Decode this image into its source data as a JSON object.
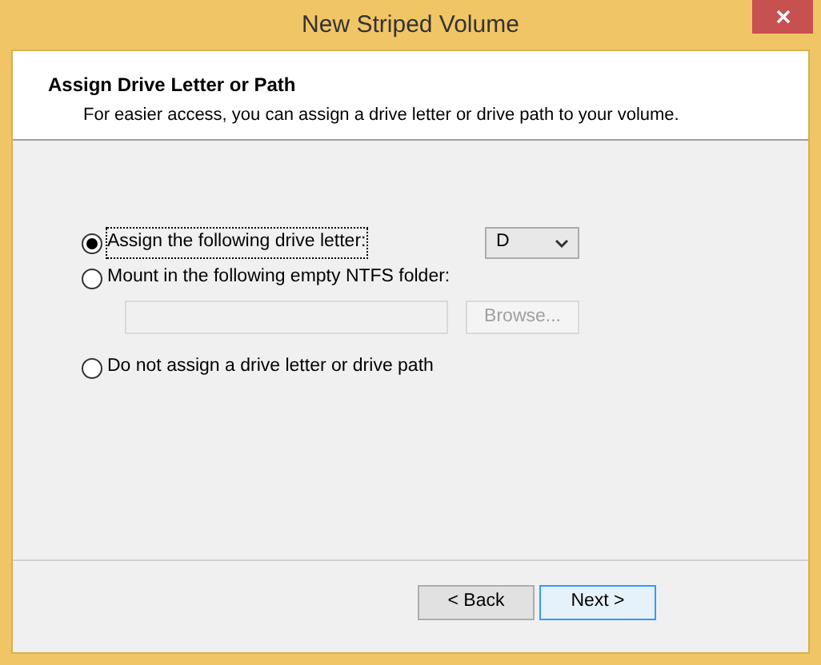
{
  "window": {
    "title": "New Striped Volume"
  },
  "header": {
    "title": "Assign Drive Letter or Path",
    "subtitle": "For easier access, you can assign a drive letter or drive path to your volume."
  },
  "options": [
    {
      "label": "Assign the following drive letter:",
      "selected": true,
      "kind": "letter",
      "value": "D"
    },
    {
      "label": "Mount in the following empty NTFS folder:",
      "selected": false,
      "kind": "folder",
      "button": "Browse..."
    },
    {
      "label": "Do not assign a drive letter or drive path",
      "selected": false,
      "kind": "none"
    }
  ],
  "buttons": [
    {
      "label": "< Back",
      "default": false
    },
    {
      "label": "Next >",
      "default": true
    }
  ]
}
